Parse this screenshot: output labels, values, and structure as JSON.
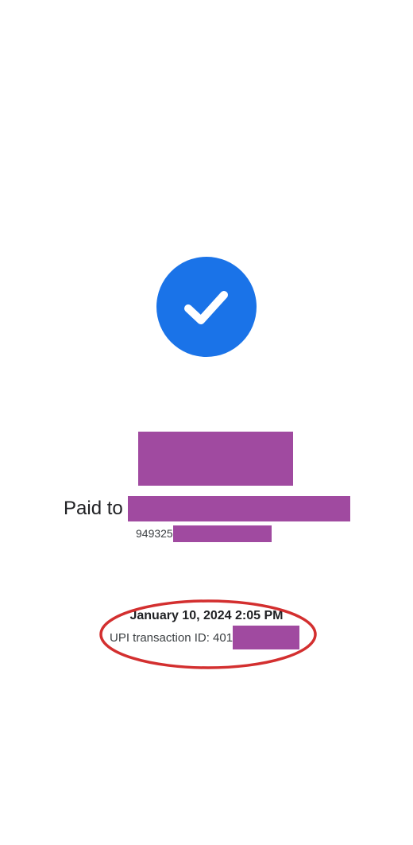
{
  "payment": {
    "status_icon": "check-icon",
    "paid_to_label": "Paid to",
    "phone_prefix": "949325",
    "datetime": "January 10, 2024 2:05 PM",
    "transaction_label": "UPI transaction ID: 401"
  },
  "colors": {
    "accent": "#1a73e8",
    "redaction": "#a04aa0",
    "annotation": "#d32f2f"
  }
}
